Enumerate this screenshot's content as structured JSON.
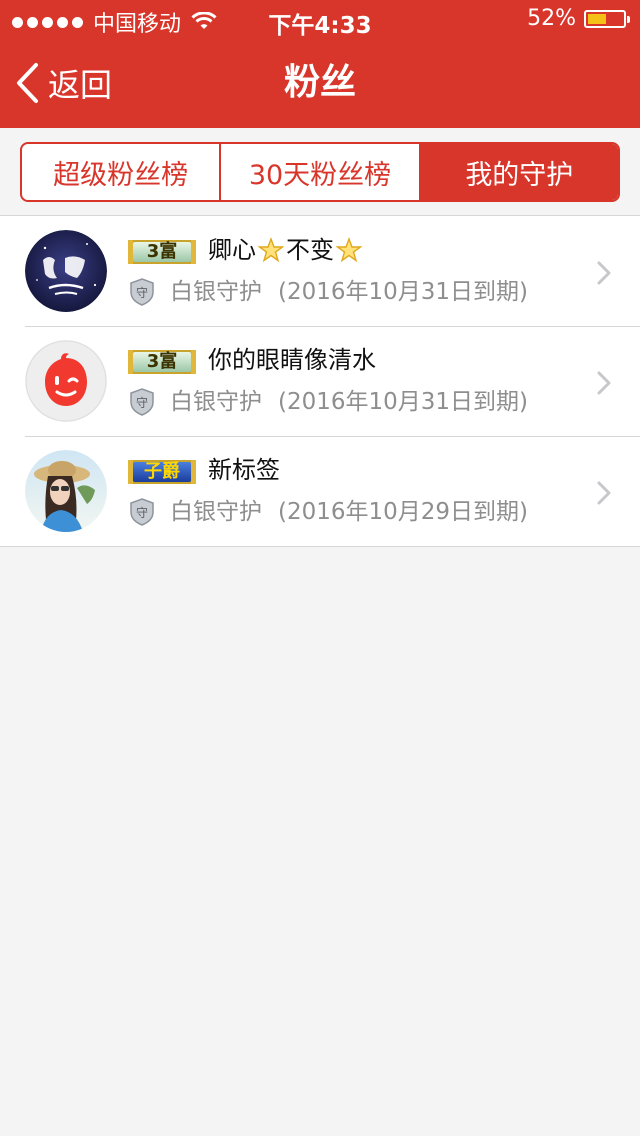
{
  "status_bar": {
    "carrier": "中国移动",
    "time": "下午4:33",
    "battery_percent": "52%",
    "battery_level": 0.52,
    "signal_icon": "signal-dots-icon",
    "wifi_icon": "wifi-icon",
    "battery_icon": "battery-icon"
  },
  "nav": {
    "back_label": "返回",
    "back_icon": "chevron-left-icon",
    "title": "粉丝"
  },
  "tabs": [
    {
      "label": "超级粉丝榜",
      "active": false
    },
    {
      "label": "30天粉丝榜",
      "active": false
    },
    {
      "label": "我的守护",
      "active": true
    }
  ],
  "fans": [
    {
      "badge": "3富",
      "badge_style": "green",
      "name": "卿心",
      "name_after_star": "不变",
      "guard": "白银守护",
      "expiry": "(2016年10月31日到期)",
      "avatar": "avatar-dark-calligraphy"
    },
    {
      "badge": "3富",
      "badge_style": "green",
      "name": "你的眼睛像清水",
      "guard": "白银守护",
      "expiry": "(2016年10月31日到期)",
      "avatar": "avatar-red-wink"
    },
    {
      "badge": "子爵",
      "badge_style": "blue",
      "name": "新标签",
      "guard": "白银守护",
      "expiry": "(2016年10月29日到期)",
      "avatar": "avatar-woman-hat"
    }
  ],
  "colors": {
    "brand_red": "#d9362b",
    "background": "#f4f4f4",
    "muted_text": "#8e8e8e",
    "battery_fill": "#f6c117"
  },
  "icons": {
    "guard_icon": "shield-icon",
    "star_icon": "star-icon",
    "row_arrow": "chevron-right-icon"
  }
}
